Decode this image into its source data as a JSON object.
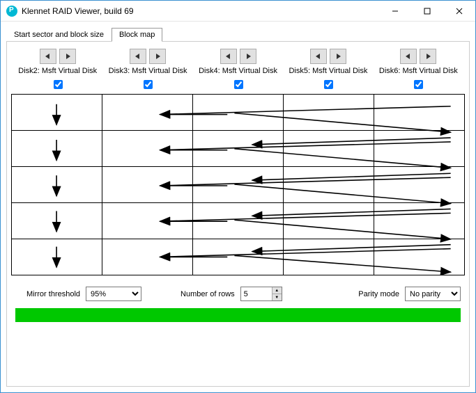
{
  "window": {
    "title": "Klennet RAID Viewer, build 69"
  },
  "tabs": {
    "start_sector": "Start sector and block size",
    "block_map": "Block map"
  },
  "disks": [
    {
      "label": "Disk2: Msft Virtual Disk",
      "checked": true
    },
    {
      "label": "Disk3: Msft Virtual Disk",
      "checked": true
    },
    {
      "label": "Disk4: Msft Virtual Disk",
      "checked": true
    },
    {
      "label": "Disk5: Msft Virtual Disk",
      "checked": true
    },
    {
      "label": "Disk6: Msft Virtual Disk",
      "checked": true
    }
  ],
  "grid": {
    "rows": 5,
    "cols": 5
  },
  "controls": {
    "mirror_label": "Mirror threshold",
    "mirror_value": "95%",
    "rows_label": "Number of rows",
    "rows_value": "5",
    "parity_label": "Parity mode",
    "parity_value": "No parity"
  },
  "colors": {
    "progress": "#00c800"
  }
}
